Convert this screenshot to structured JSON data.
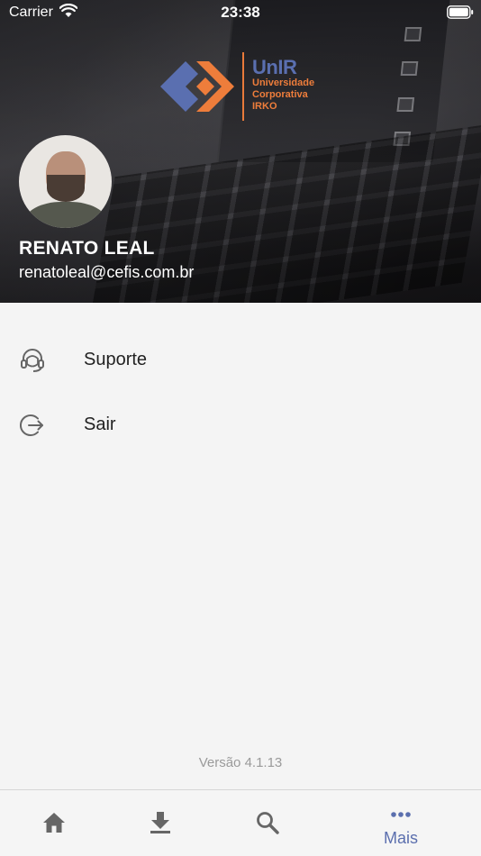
{
  "status_bar": {
    "carrier": "Carrier",
    "time": "23:38"
  },
  "logo": {
    "brand": "UnIR",
    "line1": "Universidade",
    "line2": "Corporativa",
    "line3": "IRKO"
  },
  "profile": {
    "name": "RENATO LEAL",
    "email": "renatoleal@cefis.com.br"
  },
  "menu": [
    {
      "label": "Suporte",
      "icon": "headset-icon"
    },
    {
      "label": "Sair",
      "icon": "logout-icon"
    }
  ],
  "version": "Versão 4.1.13",
  "tabs": [
    {
      "icon": "home-icon",
      "label": ""
    },
    {
      "icon": "download-icon",
      "label": ""
    },
    {
      "icon": "search-icon",
      "label": ""
    },
    {
      "icon": "more-icon",
      "label": "Mais",
      "active": true
    }
  ],
  "colors": {
    "accent": "#5b6fae",
    "brand_orange": "#ee7d3b",
    "brand_blue": "#5a6fb0"
  }
}
